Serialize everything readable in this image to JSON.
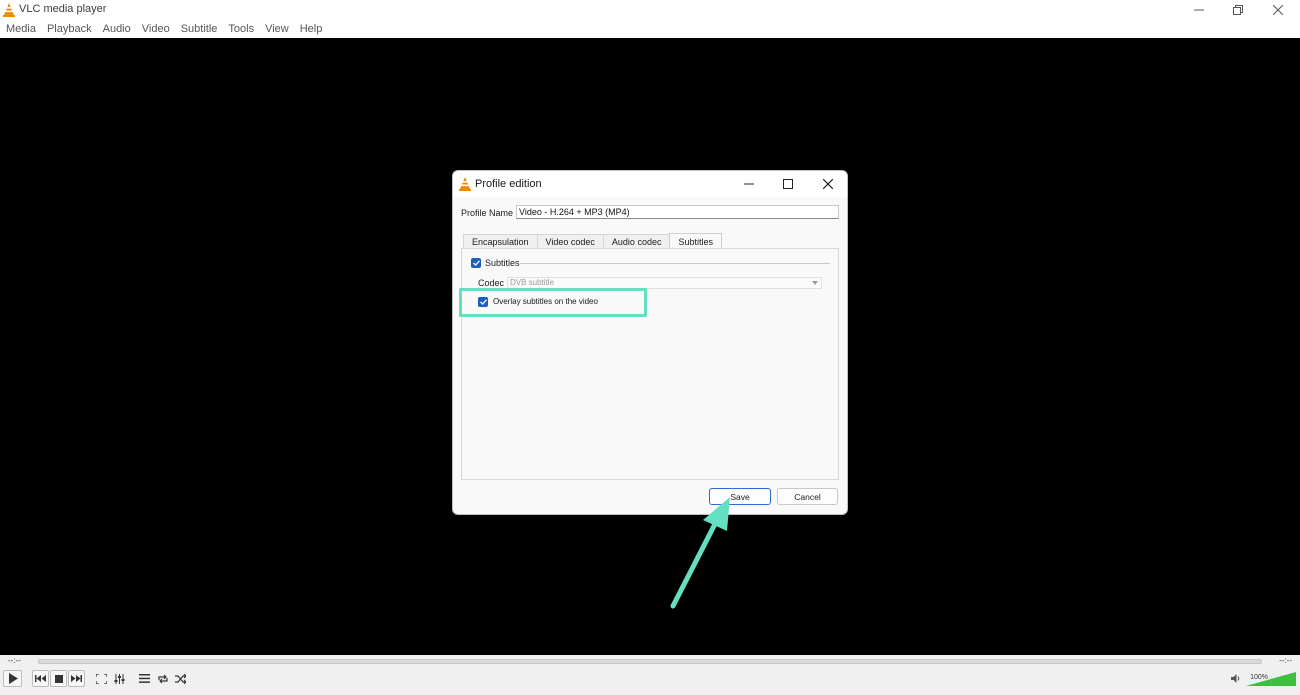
{
  "window": {
    "title": "VLC media player",
    "icon": "vlc-cone-icon"
  },
  "menubar": {
    "items": [
      "Media",
      "Playback",
      "Audio",
      "Video",
      "Subtitle",
      "Tools",
      "View",
      "Help"
    ]
  },
  "player": {
    "time_elapsed": "--:--",
    "time_remaining": "--:--",
    "volume": "100%",
    "volume_level": 1.0
  },
  "dialog": {
    "title": "Profile edition",
    "profile_name_label": "Profile Name",
    "profile_name_value": "Video - H.264 + MP3 (MP4)",
    "tabs": [
      {
        "label": "Encapsulation",
        "active": false
      },
      {
        "label": "Video codec",
        "active": false
      },
      {
        "label": "Audio codec",
        "active": false
      },
      {
        "label": "Subtitles",
        "active": true
      }
    ],
    "subtitles": {
      "group_label": "Subtitles",
      "group_checked": true,
      "codec_label": "Codec",
      "codec_value": "DVB subtitle",
      "overlay_label": "Overlay subtitles on the video",
      "overlay_checked": true
    },
    "buttons": {
      "save": "Save",
      "cancel": "Cancel"
    }
  },
  "colors": {
    "highlight": "#63e0c1",
    "checkbox": "#1d5fbf",
    "vlc_orange": "#f28a00",
    "volume_green": "#3fbf3f"
  }
}
